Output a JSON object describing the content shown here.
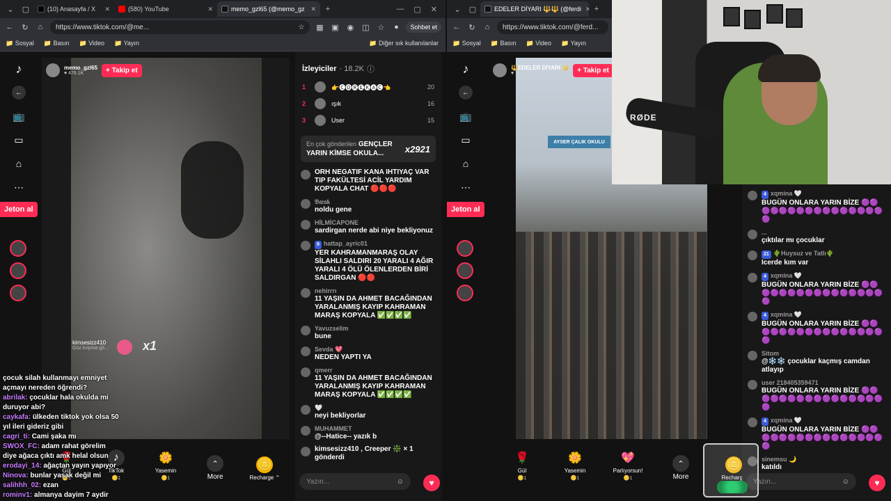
{
  "left_window": {
    "tabs": [
      {
        "label": "(10) Anasayfa / X",
        "icon": "x-icon",
        "color": "#000000"
      },
      {
        "label": "(580) YouTube",
        "icon": "youtube-icon",
        "color": "#ff0000"
      },
      {
        "label": "memo_gzl65 (@memo_gz",
        "icon": "tiktok-icon",
        "color": "#111111"
      }
    ],
    "url": "https://www.tiktok.com/@me...",
    "chat_button": "Sohbet et",
    "bookmarks": [
      "Sosyal",
      "Basın",
      "Video",
      "Yayın"
    ],
    "other_bookmarks": "Diğer sık kullanılanlar",
    "jeton": "Jeton al",
    "host": {
      "name": "memo_gzl65",
      "likes": "♥ 476.1K",
      "follow": "+ Takip et"
    },
    "gift_overlay_user": "kimsesizz410",
    "gift_overlay_sub": "Göz kırpma gö...",
    "gift_overlay_mult": "x1",
    "viewers_title": "İzleyiciler",
    "viewers_count": "· 18.2K",
    "top_viewers": [
      {
        "rank": "1",
        "name": "👉🅒🅞🅡🅔🅚🅐🅒👈",
        "score": "20"
      },
      {
        "rank": "2",
        "name": "ışık",
        "score": "16"
      },
      {
        "rank": "3",
        "name": "User",
        "score": "15"
      }
    ],
    "top_gift": {
      "label": "En çok gönderilen",
      "name": "GENÇLER YARIN KİMSE OKULA...",
      "mult": "x2921"
    },
    "messages": [
      {
        "user": "",
        "text": "ORH NEGATIF KANA IHTIYAÇ VAR TIP FAKÜLTESİ ACİL YARDIM KOPYALA CHAT 🔴🔴🔴",
        "badge": ""
      },
      {
        "user": "𝔅𝔞𝔯𝔞𝔨",
        "text": "noldu gene",
        "badge": ""
      },
      {
        "user": "HİLMİCAPONE",
        "text": "sardirgan nerde abi niye bekliyonuz",
        "badge": ""
      },
      {
        "user": "hattap_ayric01",
        "text": "YER KAHRAMANMARAŞ OLAY SİLAHLI SALDIRI 20 YARALI 4 AĞIR YARALI 4 ÖLÜ ÖLENLERDEN BİRİ SALDIRGAN 🔴🔴",
        "badge": "9"
      },
      {
        "user": "nehirrrı",
        "text": "11 YAŞIN DA AHMET BACAĞINDAN YARALANMIŞ KAYIP KAHRAMAN MARAŞ KOPYALA ✅✅✅✅",
        "badge": ""
      },
      {
        "user": "Yavuzselim",
        "text": "bune",
        "badge": ""
      },
      {
        "user": "Sevda 💖",
        "text": "NEDEN YAPTI YA",
        "badge": ""
      },
      {
        "user": "qmerr",
        "text": "11 YAŞIN DA AHMET BACAĞINDAN YARALANMIŞ KAYIP KAHRAMAN MARAŞ KOPYALA ✅✅✅✅",
        "badge": ""
      },
      {
        "user": "🤍",
        "text": "neyi bekliyorlar",
        "badge": ""
      },
      {
        "user": "MUHAMMET",
        "text": "@--Hatice-- yazık b",
        "badge": ""
      },
      {
        "user": "",
        "text": "kimsesizz410 , Creeper ❇️ × 1 gönderdi",
        "badge": ""
      }
    ],
    "input_placeholder": "Yazın...",
    "gifts": [
      {
        "label": "Gül",
        "count": "🪙1",
        "icon": "🌹"
      },
      {
        "label": "TikTok",
        "count": "🪙1",
        "icon": "♪"
      },
      {
        "label": "Yasemin",
        "count": "🪙1",
        "icon": "🌼"
      },
      {
        "label": "More",
        "count": "",
        "icon": "⌃"
      },
      {
        "label": "Recharge ⌃",
        "count": "",
        "icon": "🪙"
      }
    ]
  },
  "right_window": {
    "tabs": [
      {
        "label": "EDELER DİYARI 🔱🔱 (@ferdi",
        "icon": "tiktok-icon",
        "color": "#111111"
      }
    ],
    "url": "https://www.tiktok.com/@ferd...",
    "bookmarks": [
      "Sosyal",
      "Basın",
      "Video",
      "Yayın"
    ],
    "jeton": "Jeton al",
    "host": {
      "name": "🔱EDELER DİYARI 🔱",
      "likes": "♥ 1.2K",
      "follow": "+ Takip et"
    },
    "sign_text": "AYSER ÇALIK OKULU",
    "messages": [
      {
        "user": "xqmina 🤍",
        "text": "BUGÜN ONLARA YARIN BİZE 🟣🟣🟣🟣🟣🟣🟣🟣🟣🟣🟣🟣🟣🟣🟣🟣🟣",
        "badge": "4"
      },
      {
        "user": "...",
        "text": "çıktılar mı çocuklar",
        "badge": ""
      },
      {
        "user": "🌵Huysuz ve Tatlı🌵",
        "text": "Icerde kım var",
        "badge": "21"
      },
      {
        "user": "xqmina 🤍",
        "text": "BUGÜN ONLARA YARIN BİZE 🟣🟣🟣🟣🟣🟣🟣🟣🟣🟣🟣🟣🟣🟣🟣🟣🟣",
        "badge": "4"
      },
      {
        "user": "xqmina 🤍",
        "text": "BUGÜN ONLARA YARIN BİZE 🟣🟣🟣🟣🟣🟣🟣🟣🟣🟣🟣🟣🟣🟣🟣🟣🟣",
        "badge": "4"
      },
      {
        "user": "Sitom",
        "text": "@❄️❄️ çocuklar kaçmış camdan atlayıp",
        "badge": ""
      },
      {
        "user": "user 218405359471",
        "text": "BUGÜN ONLARA YARIN BİZE 🟣🟣🟣🟣🟣🟣🟣🟣🟣🟣🟣🟣🟣🟣🟣🟣🟣",
        "badge": ""
      },
      {
        "user": "xqmina 🤍",
        "text": "BUGÜN ONLARA YARIN BİZE 🟣🟣🟣🟣🟣🟣🟣🟣🟣🟣🟣🟣🟣🟣🟣🟣🟣",
        "badge": "4"
      },
      {
        "user": "sinemsu 🌙",
        "text": "katıldı",
        "badge": ""
      }
    ],
    "input_placeholder": "Yazın...",
    "gifts": [
      {
        "label": "Gül",
        "count": "🪙1",
        "icon": "🌹"
      },
      {
        "label": "Yasemin",
        "count": "🪙1",
        "icon": "🌼"
      },
      {
        "label": "Parlıyorsun!",
        "count": "🪙1",
        "icon": "💖"
      },
      {
        "label": "More",
        "count": "",
        "icon": "⌃"
      },
      {
        "label": "Recharge",
        "count": "",
        "icon": "🪙"
      }
    ]
  },
  "stream_overlay_chat": [
    {
      "user": "",
      "text": "çocuk silah kullanmayı emniyet açmayı nereden öğrendi?"
    },
    {
      "user": "abrilak:",
      "text": "çocuklar hala okulda mi duruyor abi?"
    },
    {
      "user": "caykafa:",
      "text": "ülkeden tiktok yok olsa 50 yıl ileri gideriz gibi"
    },
    {
      "user": "cagri_ti:",
      "text": "Cami şaka mı"
    },
    {
      "user": "SWOX_FC:",
      "text": "adam rahat görelim diye ağaca çıktı amk helal olsun"
    },
    {
      "user": "erodayi_14:",
      "text": "ağaçtan yayın yapıyor"
    },
    {
      "user": "Ninova:",
      "text": "bunlar yasak değil mi"
    },
    {
      "user": "salihhh_02:",
      "text": "ezan"
    },
    {
      "user": "rominv1:",
      "text": "almanya dayim 7 aydir ezan duymuyordum"
    }
  ],
  "webcam": {
    "mic_brand": "RØDE"
  },
  "colors": {
    "accent": "#fe2c55",
    "bg": "#121212",
    "chat_bg": "#181818",
    "overlay_user": "#c77dff"
  }
}
